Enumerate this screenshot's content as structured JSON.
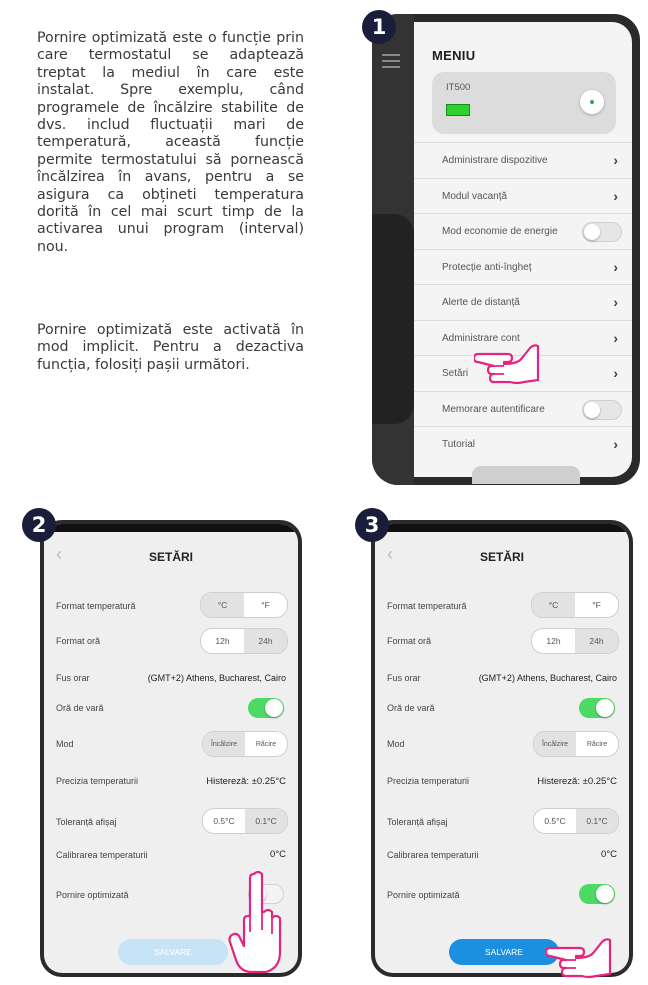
{
  "intro": {
    "paragraph1": "Pornire optimizată este o funcție prin care termostatul se adaptează treptat la mediul în care este instalat. Spre exemplu, când programele de încălzire stabilite de dvs. includ fluctuații mari de temperatură, această funcție permite termostatului să pornească încălzirea în avans, pentru a se asigura ca obțineti temperatura dorită în cel mai scurt timp de la activarea unui program (interval) nou.",
    "paragraph2": "Pornire optimizată este activată în mod implicit. Pentru a dezactiva funcția, folosiți pașii următori."
  },
  "steps": [
    "1",
    "2",
    "3"
  ],
  "menu": {
    "title": "MENIU",
    "device_name": "IT500",
    "items": [
      {
        "label": "Administrare dispozitive",
        "control": "chevron"
      },
      {
        "label": "Modul vacanță",
        "control": "chevron"
      },
      {
        "label": "Mod economie de energie",
        "control": "toggle-off"
      },
      {
        "label": "Protecție anti-îngheț",
        "control": "chevron"
      },
      {
        "label": "Alerte de distanță",
        "control": "chevron"
      },
      {
        "label": "Administrare cont",
        "control": "chevron"
      },
      {
        "label": "Setări",
        "control": "chevron"
      },
      {
        "label": "Memorare autentificare",
        "control": "toggle-off"
      },
      {
        "label": "Tutorial",
        "control": "chevron"
      }
    ]
  },
  "settings": {
    "title": "SETĂRI",
    "temp_format_label": "Format temperatură",
    "temp_options": [
      "°C",
      "°F"
    ],
    "time_format_label": "Format oră",
    "time_options": [
      "12h",
      "24h"
    ],
    "timezone_label": "Fus orar",
    "timezone_value": "(GMT+2) Athens, Bucharest, Cairo",
    "dst_label": "Oră de vară",
    "mode_label": "Mod",
    "mode_options": [
      "Încălzire",
      "Răcire"
    ],
    "precision_label": "Precizia temperaturii",
    "precision_value": "Histereză: ±0.25°C",
    "tolerance_label": "Toleranță afișaj",
    "tolerance_options": [
      "0.5°C",
      "0.1°C"
    ],
    "calibration_label": "Calibrarea temperaturii",
    "calibration_value": "0°C",
    "optimized_label": "Pornire optimizată",
    "save_label": "SALVARE"
  },
  "colors": {
    "badge": "#1b1e3a",
    "toggle_on": "#4cd964",
    "save_active": "#1d8fe0",
    "save_disabled": "#c7e4f6",
    "hand": "#e6237e"
  }
}
